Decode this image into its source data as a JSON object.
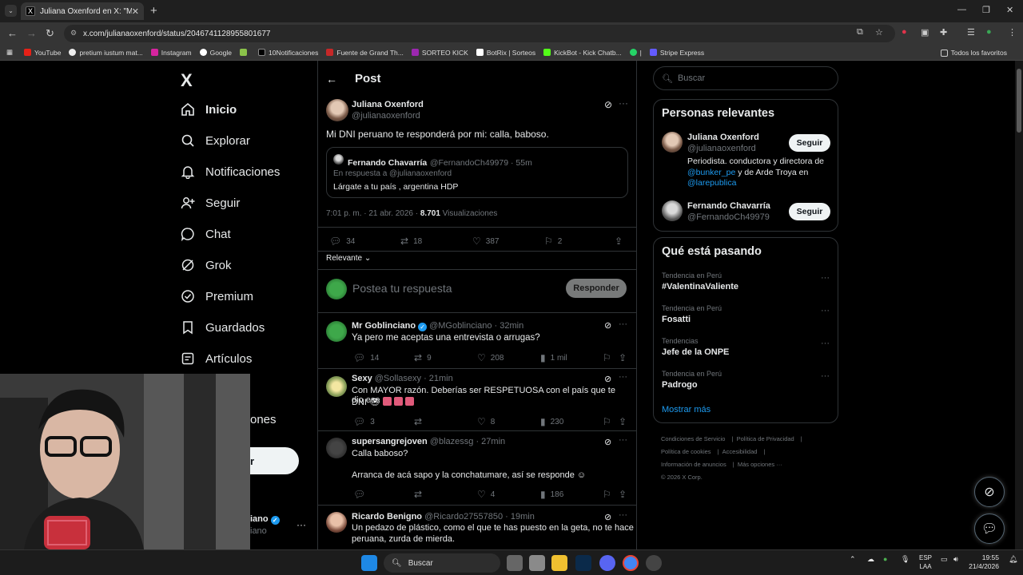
{
  "browser": {
    "tab_title": "Juliana Oxenford en X: \"Mi DNI",
    "tab_favicon": "X",
    "url": "x.com/julianaoxenford/status/2046741128955801677",
    "bookmarks": [
      "YouTube",
      "pretium iustum mat...",
      "Instagram",
      "Google",
      "10Notificaciones",
      "Fuente de Grand Th...",
      "SORTEO KICK",
      "BotRix | Sorteos",
      "KickBot - Kick Chatb...",
      "Stripe Express"
    ],
    "all_bookmarks": "Todos los favoritos"
  },
  "nav": {
    "logo": "X",
    "items": [
      "Inicio",
      "Explorar",
      "Notificaciones",
      "Seguir",
      "Chat",
      "Grok",
      "Premium",
      "Guardados",
      "Artículos"
    ],
    "partial_more": "ones",
    "partial_post_btn": "r",
    "account_name_partial": "iano",
    "account_handle_partial": "iano",
    "account_more": "···"
  },
  "post": {
    "header": "Post",
    "author": "Juliana Oxenford",
    "handle": "@julianaoxenford",
    "text": "Mi DNI peruano te responderá por mi: calla, baboso.",
    "quote": {
      "author": "Fernando Chavarría",
      "handle_time": "@FernandoCh49979 · 55m",
      "reply_to_prefix": "En respuesta a",
      "reply_to": "@julianaoxenford",
      "text": "Lárgate a tu país , argentina HDP"
    },
    "time": "7:01 p. m. · 21 abr. 2026 ·",
    "views": "8.701",
    "views_label": "Visualizaciones",
    "replies": "34",
    "reposts": "18",
    "likes": "387",
    "bookmarks": "2",
    "sort": "Relevante",
    "reply_placeholder": "Postea tu respuesta",
    "reply_button": "Responder"
  },
  "replies": [
    {
      "name": "Mr Goblinciano",
      "verified": true,
      "meta": "@MGoblinciano · 32min",
      "text": "Ya pero me aceptas una entrevista o arrugas?",
      "text2": "",
      "replies": "14",
      "reposts": "9",
      "likes": "208",
      "views": "1 mil"
    },
    {
      "name": "Sexy",
      "verified": false,
      "meta": "@Sollasexy · 21min",
      "text": "Con MAYOR razón.  Deberías ser RESPETUOSA con el país que te dio ese",
      "text2": "DNI",
      "replies": "3",
      "reposts": "",
      "likes": "8",
      "views": "230"
    },
    {
      "name": "supersangrejoven",
      "verified": false,
      "meta": "@blazessg · 27min",
      "text": "Calla baboso?",
      "text2": "Arranca de acá sapo y la conchatumare, así se responde",
      "replies": "",
      "reposts": "",
      "likes": "4",
      "views": "186"
    },
    {
      "name": "Ricardo Benigno",
      "verified": false,
      "meta": "@Ricardo27557850 · 19min",
      "text": "Un pedazo de plástico, como el que te has puesto en la geta, no te hace",
      "text2": "peruana, zurda de mierda.",
      "replies": "",
      "reposts": "",
      "likes": "",
      "views": ""
    }
  ],
  "sidebar": {
    "search_placeholder": "Buscar",
    "relevant_title": "Personas relevantes",
    "people": [
      {
        "name": "Juliana Oxenford",
        "handle": "@julianaoxenford",
        "bio_1": "Periodista. conductora y directora de",
        "bio_link_1": "@bunker_pe",
        "bio_2": " y de Arde Troya en",
        "bio_link_2": "@larepublica",
        "follow": "Seguir"
      },
      {
        "name": "Fernando Chavarría",
        "handle": "@FernandoCh49979",
        "follow": "Seguir"
      }
    ],
    "trends_title": "Qué está pasando",
    "trends": [
      {
        "context": "Tendencia en Perú",
        "topic": "#ValentinaValiente"
      },
      {
        "context": "Tendencia en Perú",
        "topic": "Fosatti"
      },
      {
        "context": "Tendencias",
        "topic": "Jefe de la ONPE"
      },
      {
        "context": "Tendencia en Perú",
        "topic": "Padrogo"
      }
    ],
    "show_more": "Mostrar más",
    "footer": [
      "Condiciones de Servicio",
      "Política de Privacidad",
      "Política de cookies",
      "Accesibilidad",
      "Información de anuncios",
      "Más opciones ···",
      "© 2026 X Corp."
    ]
  },
  "taskbar": {
    "search": "Buscar",
    "lang": "ESP",
    "layout": "LAA",
    "time": "19:55",
    "date": "21/4/2026"
  },
  "colors": {
    "accent": "#1d9bf0",
    "border": "#2f3336",
    "muted": "#71767b"
  }
}
